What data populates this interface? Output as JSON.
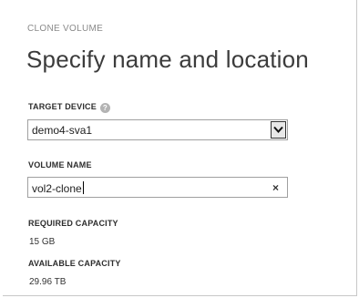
{
  "dialog": {
    "kicker": "CLONE VOLUME",
    "title": "Specify name and location"
  },
  "target_device": {
    "label": "TARGET DEVICE",
    "help_icon": "?",
    "selected_value": "demo4-sva1"
  },
  "volume_name": {
    "label": "VOLUME NAME",
    "value": "vol2-clone",
    "clear_icon": "×"
  },
  "required_capacity": {
    "label": "REQUIRED CAPACITY",
    "value": "15 GB"
  },
  "available_capacity": {
    "label": "AVAILABLE CAPACITY",
    "value": "29.96 TB"
  }
}
